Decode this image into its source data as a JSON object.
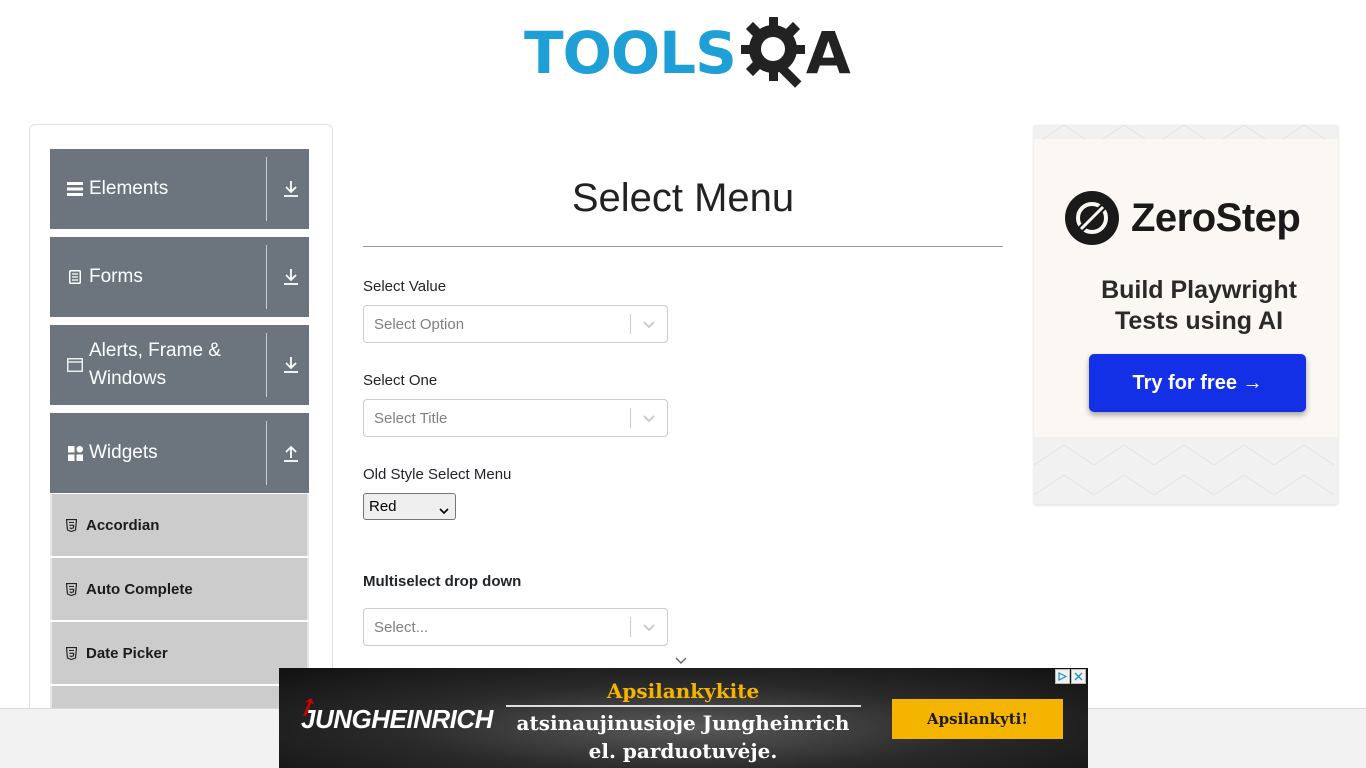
{
  "header": {
    "logo_text": "TOOLS",
    "logo_suffix": "A"
  },
  "sidebar": {
    "groups": [
      {
        "label": "Elements",
        "icon": "hamburger-icon",
        "expanded": false
      },
      {
        "label": "Forms",
        "icon": "document-icon",
        "expanded": false
      },
      {
        "label": "Alerts, Frame & Windows",
        "icon": "window-icon",
        "expanded": false
      },
      {
        "label": "Widgets",
        "icon": "widgets-icon",
        "expanded": true
      }
    ],
    "items": [
      {
        "label": "Accordian"
      },
      {
        "label": "Auto Complete"
      },
      {
        "label": "Date Picker"
      }
    ]
  },
  "main": {
    "title": "Select Menu",
    "select_value": {
      "label": "Select Value",
      "placeholder": "Select Option"
    },
    "select_one": {
      "label": "Select One",
      "placeholder": "Select Title"
    },
    "old_style": {
      "label": "Old Style Select Menu",
      "selected": "Red"
    },
    "multiselect": {
      "label": "Multiselect drop down",
      "placeholder": "Select..."
    }
  },
  "ad_right": {
    "brand": "ZeroStep",
    "tagline_line1": "Build Playwright",
    "tagline_line2": "Tests using AI",
    "cta": "Try for free →"
  },
  "ad_bottom": {
    "brand": "JUNGHEINRICH",
    "line1": "Apsilankykite",
    "line2": "atsinaujinusioje Jungheinrich",
    "line3": "el. parduotuvėje.",
    "cta": "Apsilankyti!",
    "accent_color": "#f5b400"
  },
  "colors": {
    "logo_blue": "#1e9fd6",
    "group_header_bg": "#6c757d",
    "menu_item_bg": "#cccccc",
    "zerostep_button": "#1430e6"
  }
}
